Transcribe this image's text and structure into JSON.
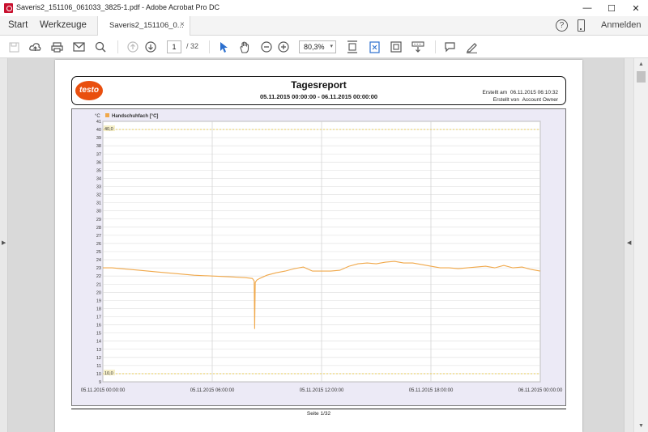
{
  "window": {
    "title": "Saveris2_151106_061033_3825-1.pdf - Adobe Acrobat Pro DC",
    "minimize": "—",
    "maximize": "☐",
    "close": "✕"
  },
  "tabs": {
    "home": "Start",
    "tools": "Werkzeuge",
    "document": "Saveris2_151106_0...",
    "document_close": "×",
    "help": "?",
    "signin": "Anmelden"
  },
  "toolbar": {
    "page_current": "1",
    "page_total": "/ 32",
    "zoom": "80,3%",
    "zoom_arrow": "▾"
  },
  "report": {
    "logo": "testo",
    "title": "Tagesreport",
    "range": "05.11.2015 00:00:00 - 06.11.2015 00:00:00",
    "created_on_label": "Erstellt am",
    "created_on": "06.11.2015 06:10:32",
    "created_by_label": "Erstellt von",
    "created_by": "Account Owner",
    "footer": "Seite 1/32"
  },
  "colors": {
    "series": "#f0a84a",
    "limit": "#e8c84a",
    "plot_bg": "#ffffff",
    "chart_bg": "#eceaf6"
  },
  "chart_data": {
    "type": "line",
    "ylabel": "°C",
    "legend": "Handschuhfach [°C]",
    "ylim": [
      9,
      41
    ],
    "yticks": [
      9,
      10,
      11,
      12,
      13,
      14,
      15,
      16,
      17,
      18,
      19,
      20,
      21,
      22,
      23,
      24,
      25,
      26,
      27,
      28,
      29,
      30,
      31,
      32,
      33,
      34,
      35,
      36,
      37,
      38,
      39,
      40,
      41
    ],
    "xlim": [
      0,
      24
    ],
    "xticks": [
      0,
      6,
      12,
      18,
      24
    ],
    "xtick_labels": [
      "05.11.2015 00:00:00",
      "05.11.2015 06:00:00",
      "05.11.2015 12:00:00",
      "05.11.2015 18:00:00",
      "06.11.2015 00:00:00"
    ],
    "limits": [
      {
        "label": "40,0",
        "value": 40.0
      },
      {
        "label": "10,0",
        "value": 10.0
      }
    ],
    "series": [
      {
        "name": "Handschuhfach [°C]",
        "x": [
          0,
          0.5,
          1,
          2,
          3,
          4,
          5,
          6,
          7,
          7.8,
          8.2,
          8.3,
          8.33,
          8.36,
          8.45,
          8.6,
          9,
          9.5,
          10,
          10.5,
          11,
          11.5,
          12,
          12.5,
          13,
          13.5,
          14,
          14.5,
          15,
          15.5,
          16,
          16.5,
          17,
          17.5,
          18,
          18.5,
          19,
          19.5,
          20,
          20.5,
          21,
          21.5,
          22,
          22.5,
          23,
          23.5,
          24
        ],
        "y": [
          23.0,
          23.0,
          22.9,
          22.7,
          22.5,
          22.3,
          22.1,
          22.0,
          21.9,
          21.8,
          21.7,
          21.4,
          15.5,
          21.2,
          21.5,
          21.7,
          22.1,
          22.4,
          22.6,
          22.9,
          23.1,
          22.6,
          22.6,
          22.6,
          22.7,
          23.2,
          23.5,
          23.6,
          23.5,
          23.7,
          23.8,
          23.6,
          23.6,
          23.4,
          23.2,
          23.0,
          23.0,
          22.9,
          23.0,
          23.1,
          23.2,
          23.0,
          23.3,
          23.0,
          23.1,
          22.8,
          22.6
        ]
      }
    ]
  }
}
